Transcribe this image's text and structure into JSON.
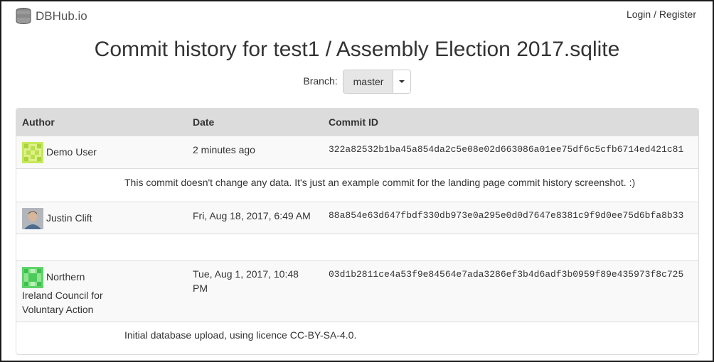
{
  "brand": {
    "name": "DBHub.io",
    "icon": "database-icon"
  },
  "auth": {
    "login_register": "Login / Register"
  },
  "page": {
    "title": "Commit history for test1 / Assembly Election 2017.sqlite"
  },
  "branch": {
    "label": "Branch:",
    "selected": "master"
  },
  "table": {
    "headers": {
      "author": "Author",
      "date": "Date",
      "commit_id": "Commit ID"
    },
    "commits": [
      {
        "author": "Demo User",
        "date": "2 minutes ago",
        "commit_id": "322a82532b1ba45a854da2c5e08e02d663086a01ee75df6c5cfb6714ed421c81",
        "message": "This commit doesn't change any data. It's just an example commit for the landing page commit history screenshot. :)"
      },
      {
        "author": "Justin Clift",
        "date": "Fri, Aug 18, 2017, 6:49 AM",
        "commit_id": "88a854e63d647fbdf330db973e0a295e0d0d7647e8381c9f9d0ee75d6bfa8b33",
        "message": ""
      },
      {
        "author_line1": "Northern",
        "author_line2": "Ireland Council for",
        "author_line3": "Voluntary Action",
        "date_line1": "Tue, Aug 1, 2017, 10:48",
        "date_line2": "PM",
        "commit_id": "03d1b2811ce4a53f9e84564e7ada3286ef3b4d6adf3b0959f89e435973f8c725",
        "message": "Initial database upload, using licence CC-BY-SA-4.0."
      }
    ]
  }
}
